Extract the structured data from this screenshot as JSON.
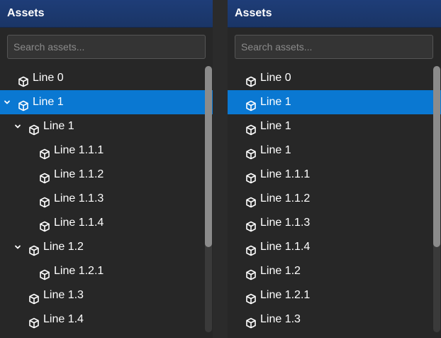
{
  "panels": [
    {
      "title": "Assets",
      "search_placeholder": "Search assets...",
      "rows": [
        {
          "label": "Line 0",
          "depth": 0,
          "chevron": false,
          "selected": false
        },
        {
          "label": "Line 1",
          "depth": 0,
          "chevron": true,
          "selected": true
        },
        {
          "label": "Line 1",
          "depth": 1,
          "chevron": true,
          "selected": false
        },
        {
          "label": "Line 1.1.1",
          "depth": 2,
          "chevron": false,
          "selected": false
        },
        {
          "label": "Line 1.1.2",
          "depth": 2,
          "chevron": false,
          "selected": false
        },
        {
          "label": "Line 1.1.3",
          "depth": 2,
          "chevron": false,
          "selected": false
        },
        {
          "label": "Line 1.1.4",
          "depth": 2,
          "chevron": false,
          "selected": false
        },
        {
          "label": "Line 1.2",
          "depth": 1,
          "chevron": true,
          "selected": false
        },
        {
          "label": "Line 1.2.1",
          "depth": 2,
          "chevron": false,
          "selected": false
        },
        {
          "label": "Line 1.3",
          "depth": 1,
          "chevron": false,
          "selected": false
        },
        {
          "label": "Line 1.4",
          "depth": 1,
          "chevron": false,
          "selected": false
        }
      ]
    },
    {
      "title": "Assets",
      "search_placeholder": "Search assets...",
      "rows": [
        {
          "label": "Line 0",
          "depth": 0,
          "chevron": false,
          "selected": false
        },
        {
          "label": "Line 1",
          "depth": 0,
          "chevron": false,
          "selected": true
        },
        {
          "label": "Line 1",
          "depth": 0,
          "chevron": false,
          "selected": false
        },
        {
          "label": "Line 1",
          "depth": 0,
          "chevron": false,
          "selected": false
        },
        {
          "label": "Line 1.1.1",
          "depth": 0,
          "chevron": false,
          "selected": false
        },
        {
          "label": "Line 1.1.2",
          "depth": 0,
          "chevron": false,
          "selected": false
        },
        {
          "label": "Line 1.1.3",
          "depth": 0,
          "chevron": false,
          "selected": false
        },
        {
          "label": "Line 1.1.4",
          "depth": 0,
          "chevron": false,
          "selected": false
        },
        {
          "label": "Line 1.2",
          "depth": 0,
          "chevron": false,
          "selected": false
        },
        {
          "label": "Line 1.2.1",
          "depth": 0,
          "chevron": false,
          "selected": false
        },
        {
          "label": "Line 1.3",
          "depth": 0,
          "chevron": false,
          "selected": false
        }
      ]
    }
  ],
  "colors": {
    "header_bg": "#1e3d78",
    "selected_bg": "#0a78d2",
    "panel_bg": "#272727"
  },
  "icons": {
    "row_icon": "cube-icon",
    "expand_icon": "chevron-down-icon"
  }
}
